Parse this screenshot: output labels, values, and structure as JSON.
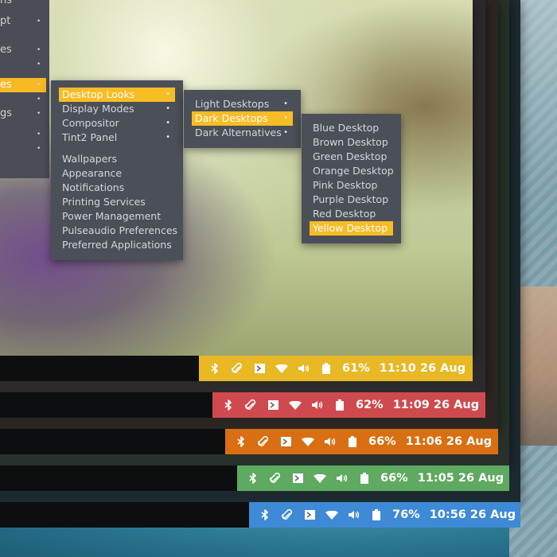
{
  "root_menu": {
    "items": [
      {
        "label": "ns",
        "has_sub": false,
        "active": false
      },
      {
        "label": "pt",
        "has_sub": true,
        "active": false
      },
      {
        "label": "es",
        "has_sub": true,
        "active": false
      },
      {
        "label": "",
        "has_sub": true,
        "active": false
      },
      {
        "label": "es",
        "has_sub": true,
        "active": true
      },
      {
        "label": "",
        "has_sub": true,
        "active": false
      },
      {
        "label": "gs",
        "has_sub": true,
        "active": false
      },
      {
        "label": "",
        "has_sub": true,
        "active": false
      },
      {
        "label": "",
        "has_sub": true,
        "active": false
      }
    ]
  },
  "menu_preferences": {
    "group1": [
      {
        "label": "Desktop Looks",
        "active": true,
        "has_sub": true
      },
      {
        "label": "Display Modes",
        "active": false,
        "has_sub": true
      },
      {
        "label": "Compositor",
        "active": false,
        "has_sub": true
      },
      {
        "label": "Tint2 Panel",
        "active": false,
        "has_sub": true
      }
    ],
    "group2": [
      {
        "label": "Wallpapers"
      },
      {
        "label": "Appearance"
      },
      {
        "label": "Notifications"
      },
      {
        "label": "Printing Services"
      },
      {
        "label": "Power Management"
      },
      {
        "label": "Pulseaudio Preferences"
      },
      {
        "label": "Preferred Applications"
      }
    ]
  },
  "menu_desktop_looks": {
    "items": [
      {
        "label": "Light Desktops",
        "active": false,
        "has_sub": true
      },
      {
        "label": "Dark Desktops",
        "active": true,
        "has_sub": true
      },
      {
        "label": "Dark Alternatives",
        "active": false,
        "has_sub": true
      }
    ]
  },
  "menu_dark_desktops": {
    "items": [
      {
        "label": "Blue Desktop",
        "active": false
      },
      {
        "label": "Brown Desktop",
        "active": false
      },
      {
        "label": "Green Desktop",
        "active": false
      },
      {
        "label": "Orange Desktop",
        "active": false
      },
      {
        "label": "Pink Desktop",
        "active": false
      },
      {
        "label": "Purple Desktop",
        "active": false
      },
      {
        "label": "Red Desktop",
        "active": false
      },
      {
        "label": "Yellow Desktop",
        "active": true
      }
    ]
  },
  "panels": [
    {
      "theme": "yellow",
      "color": "#e8b825",
      "battery": "61%",
      "clock": "11:10 26 Aug"
    },
    {
      "theme": "red",
      "color": "#cf4a4e",
      "battery": "62%",
      "clock": "11:09 26 Aug"
    },
    {
      "theme": "orange",
      "color": "#d96f12",
      "battery": "66%",
      "clock": "11:06 26 Aug"
    },
    {
      "theme": "green",
      "color": "#5eaa60",
      "battery": "66%",
      "clock": "11:05 26 Aug"
    },
    {
      "theme": "blue",
      "color": "#3e8ad6",
      "battery": "76%",
      "clock": "10:56 26 Aug"
    }
  ],
  "tray_icons": [
    "bluetooth-icon",
    "paperclip-icon",
    "terminal-icon",
    "wifi-icon",
    "volume-icon",
    "battery-icon"
  ],
  "colors": {
    "menu_bg": "#4b4f58",
    "menu_text": "#d3d6da",
    "highlight": "#f8bc25",
    "taskbar_bg": "#0c0e10"
  }
}
